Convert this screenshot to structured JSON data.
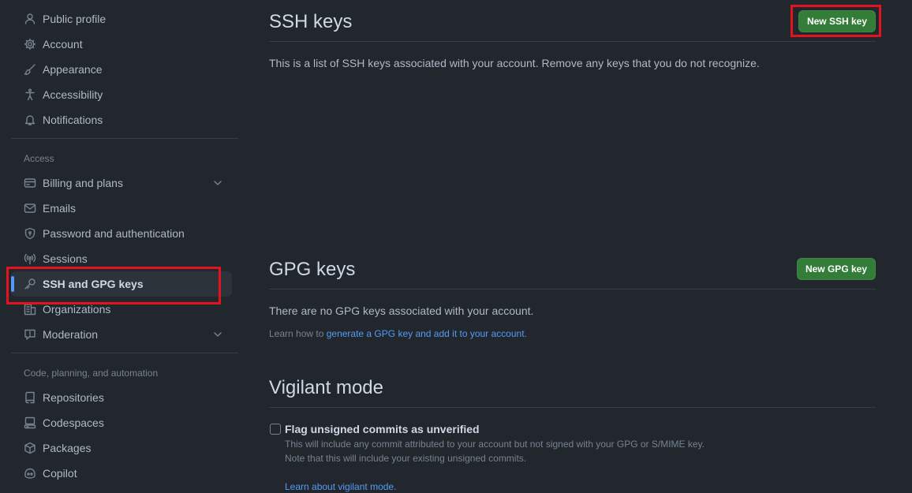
{
  "sidebar": {
    "top_items": [
      {
        "label": "Public profile",
        "icon": "person-icon"
      },
      {
        "label": "Account",
        "icon": "gear-icon"
      },
      {
        "label": "Appearance",
        "icon": "paintbrush-icon"
      },
      {
        "label": "Accessibility",
        "icon": "accessibility-icon"
      },
      {
        "label": "Notifications",
        "icon": "bell-icon"
      }
    ],
    "access_label": "Access",
    "access_items": [
      {
        "label": "Billing and plans",
        "icon": "credit-card-icon",
        "expandable": true
      },
      {
        "label": "Emails",
        "icon": "mail-icon"
      },
      {
        "label": "Password and authentication",
        "icon": "shield-lock-icon"
      },
      {
        "label": "Sessions",
        "icon": "broadcast-icon"
      },
      {
        "label": "SSH and GPG keys",
        "icon": "key-icon",
        "active": true
      },
      {
        "label": "Organizations",
        "icon": "organization-icon"
      },
      {
        "label": "Moderation",
        "icon": "report-icon",
        "expandable": true
      }
    ],
    "code_label": "Code, planning, and automation",
    "code_items": [
      {
        "label": "Repositories",
        "icon": "repo-icon"
      },
      {
        "label": "Codespaces",
        "icon": "codespaces-icon"
      },
      {
        "label": "Packages",
        "icon": "package-icon"
      },
      {
        "label": "Copilot",
        "icon": "copilot-icon"
      }
    ]
  },
  "ssh": {
    "title": "SSH keys",
    "button": "New SSH key",
    "description": "This is a list of SSH keys associated with your account. Remove any keys that you do not recognize."
  },
  "gpg": {
    "title": "GPG keys",
    "button": "New GPG key",
    "empty": "There are no GPG keys associated with your account.",
    "learn_prefix": "Learn how to ",
    "learn_link": "generate a GPG key and add it to your account",
    "learn_suffix": "."
  },
  "vigilant": {
    "title": "Vigilant mode",
    "checkbox_label": "Flag unsigned commits as unverified",
    "note_line1": "This will include any commit attributed to your account but not signed with your GPG or S/MIME key.",
    "note_line2": "Note that this will include your existing unsigned commits.",
    "learn_link": "Learn about vigilant mode",
    "learn_suffix": "."
  },
  "colors": {
    "accent": "#539bf5",
    "button_green": "#347d39",
    "highlight_box": "#e3141f",
    "background": "#22272e"
  }
}
